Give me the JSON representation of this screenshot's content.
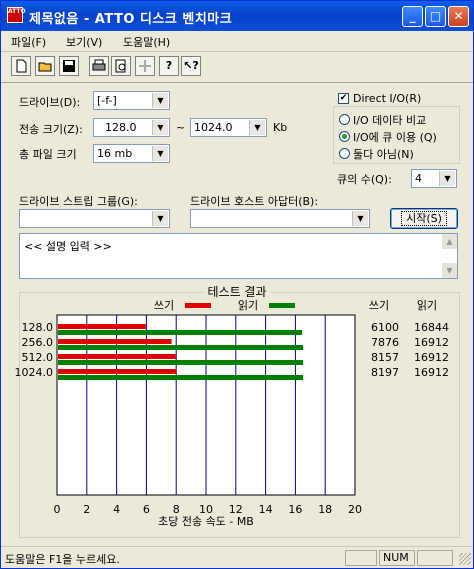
{
  "window": {
    "title": "제목없음 - ATTO 디스크 벤치마크",
    "icon_text": "ATTO"
  },
  "titlebar_buttons": {
    "minimize": "_",
    "maximize": "□",
    "close": "✕"
  },
  "menu": [
    "파일(F)",
    "보기(V)",
    "도움말(H)"
  ],
  "form": {
    "drive_label": "드라이브(D):",
    "drive_value": "[-f-]",
    "transfer_label": "전송 크기(Z):",
    "transfer_from": "128.0",
    "tilde": "~",
    "transfer_to": "1024.0",
    "transfer_unit": "Kb",
    "total_label": "총 파일 크기",
    "total_value": "16 mb",
    "direct_io_label": "Direct I/O(R)",
    "direct_io_checked": true,
    "radio_options": [
      "I/O 데이타 비교",
      "I/O에 큐 이용 (Q)",
      "둘다 아님(N)"
    ],
    "radio_selected": 1,
    "queue_label": "큐의 수(Q):",
    "queue_value": "4",
    "stripe_label": "드라이브 스트립 그룹(G):",
    "stripe_value": "",
    "host_label": "드라이브 호스트 아답터(B):",
    "host_value": "",
    "start_button": "시작(S)",
    "description": "<< 설명 입력 >>"
  },
  "results": {
    "title": "테스트 결과",
    "legend_write": "쓰기",
    "legend_read": "읽기",
    "col_write": "쓰기",
    "col_read": "읽기",
    "xlabel": "초당 전송 속도 - MB"
  },
  "colors": {
    "write": "#e00000",
    "read": "#008000",
    "grid": "#00008b"
  },
  "chart_data": {
    "type": "bar",
    "categories": [
      "128.0",
      "256.0",
      "512.0",
      "1024.0"
    ],
    "series": [
      {
        "name": "쓰기",
        "values": [
          6100,
          7876,
          8157,
          8197
        ]
      },
      {
        "name": "읽기",
        "values": [
          16844,
          16912,
          16912,
          16912
        ]
      }
    ],
    "xlim": [
      0,
      20
    ],
    "xticks": [
      "0",
      "2",
      "4",
      "6",
      "8",
      "10",
      "12",
      "14",
      "16",
      "18",
      "20"
    ],
    "xlabel": "초당 전송 속도 - MB",
    "legend_placement": "top"
  },
  "status": {
    "text": "도움말은 F1을 누르세요.",
    "num": "NUM"
  }
}
